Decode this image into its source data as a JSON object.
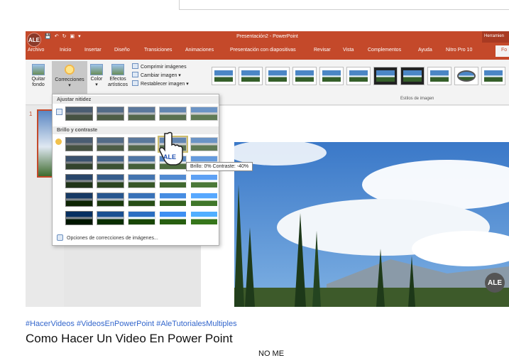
{
  "window": {
    "title": "Presentación2 - PowerPoint",
    "tools_tab": "Herramien",
    "avatar_text": "ALE"
  },
  "tabs": [
    "Archivo",
    "Inicio",
    "Insertar",
    "Diseño",
    "Transiciones",
    "Animaciones",
    "Presentación con diapositivas",
    "Revisar",
    "Vista",
    "Complementos",
    "Ayuda",
    "Nitro Pro 10",
    "Fo"
  ],
  "ribbon": {
    "quitar_fondo": "Quitar fondo",
    "correcciones": "Correcciones",
    "color": "Color",
    "efectos": "Efectos artísticos",
    "comprimir": "Comprimir imágenes",
    "cambiar": "Cambiar imagen",
    "restablecer": "Restablecer imagen",
    "estilos_label": "Estilos de imagen"
  },
  "slides_pane": {
    "slide_number": "1"
  },
  "corrections_menu": {
    "section_sharpen": "Ajustar nitidez",
    "section_brightness": "Brillo y contraste",
    "tooltip": "Brillo: 0% Contraste: -40%",
    "footer": "Opciones de correcciones de imágenes..."
  },
  "watermark": "ALE",
  "video": {
    "hashtags": "#HacerVideos #VideosEnPowerPoint #AleTutorialesMultiples",
    "title": "Como Hacer Un Video En Power Point",
    "cutoff_text": "NO ME"
  },
  "colors": {
    "accent": "#c4492a",
    "link": "#3366cc"
  }
}
